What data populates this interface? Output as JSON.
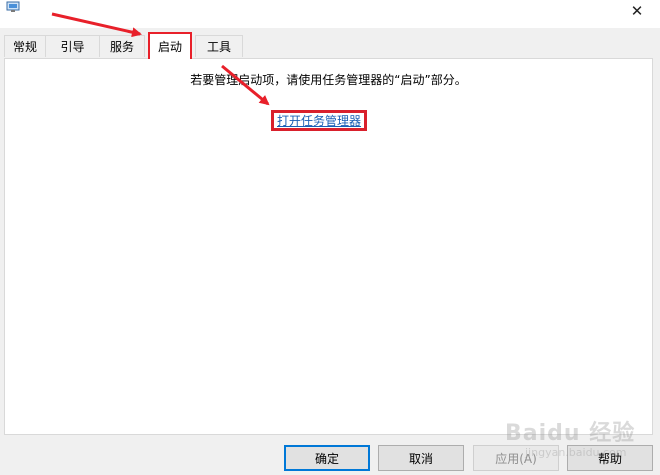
{
  "window": {
    "icon": "system-config-icon",
    "close_glyph": "✕"
  },
  "tabs": [
    {
      "label": "常规"
    },
    {
      "label": "引导"
    },
    {
      "label": "服务"
    },
    {
      "label": "启动",
      "active": true
    },
    {
      "label": "工具"
    }
  ],
  "startup_panel": {
    "info_text": "若要管理启动项，请使用任务管理器的“启动”部分。",
    "link_label": "打开任务管理器"
  },
  "buttons": {
    "ok": "确定",
    "cancel": "取消",
    "apply": "应用(A)",
    "help": "帮助"
  },
  "watermark": {
    "text": "Baidu 经验",
    "sub": "jingyan.baidu.com"
  },
  "colors": {
    "annotation_red": "#e8202a",
    "link_blue": "#1a5fb4",
    "primary_border": "#0078d7"
  }
}
